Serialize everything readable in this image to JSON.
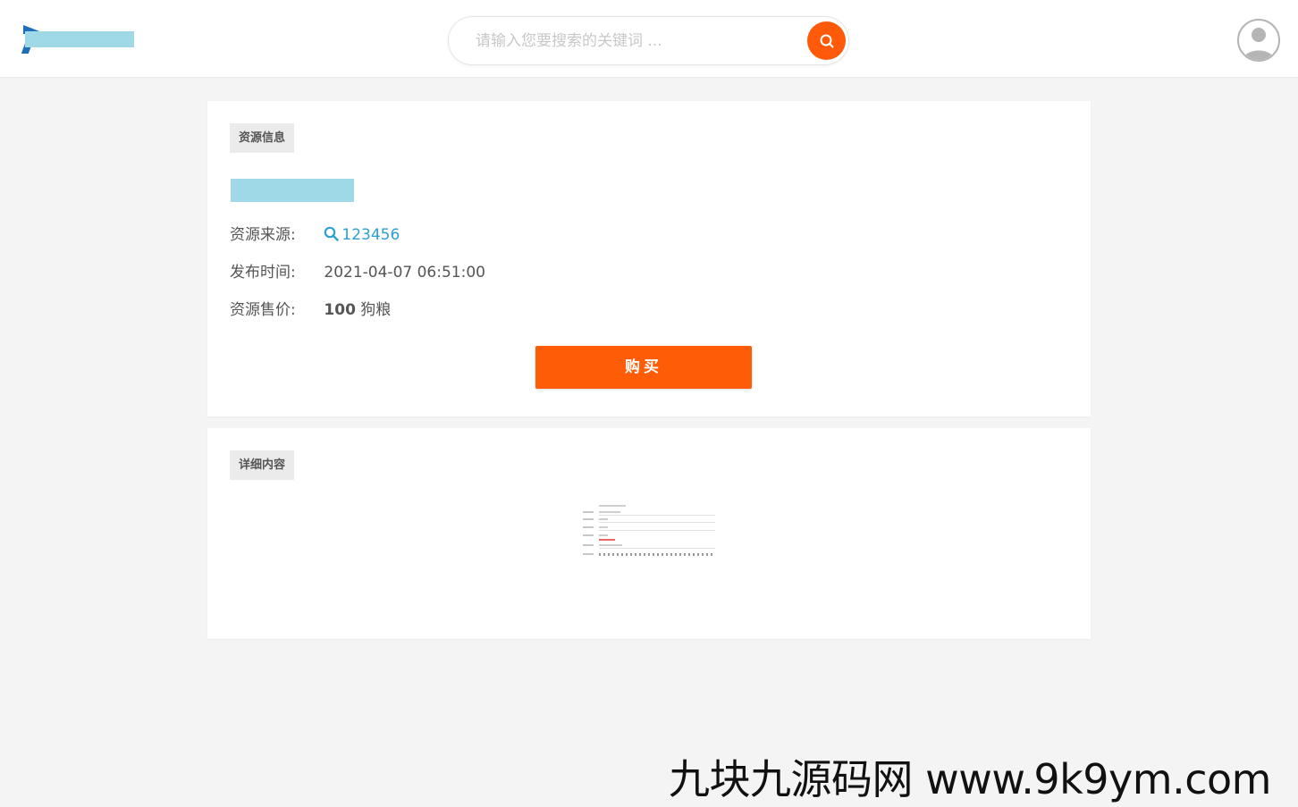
{
  "header": {
    "search_placeholder": "请输入您要搜索的关键词 ...",
    "accent_color": "#fe5a0a"
  },
  "resource_card": {
    "tag": "资源信息",
    "source_label": "资源来源:",
    "source_value": "123456",
    "time_label": "发布时间:",
    "time_value": "2021-04-07 06:51:00",
    "price_label": "资源售价:",
    "price_amount": "100",
    "price_unit": " 狗粮",
    "buy_label": "购买"
  },
  "detail_card": {
    "tag": "详细内容"
  },
  "watermark": "九块九源码网 www.9k9ym.com"
}
